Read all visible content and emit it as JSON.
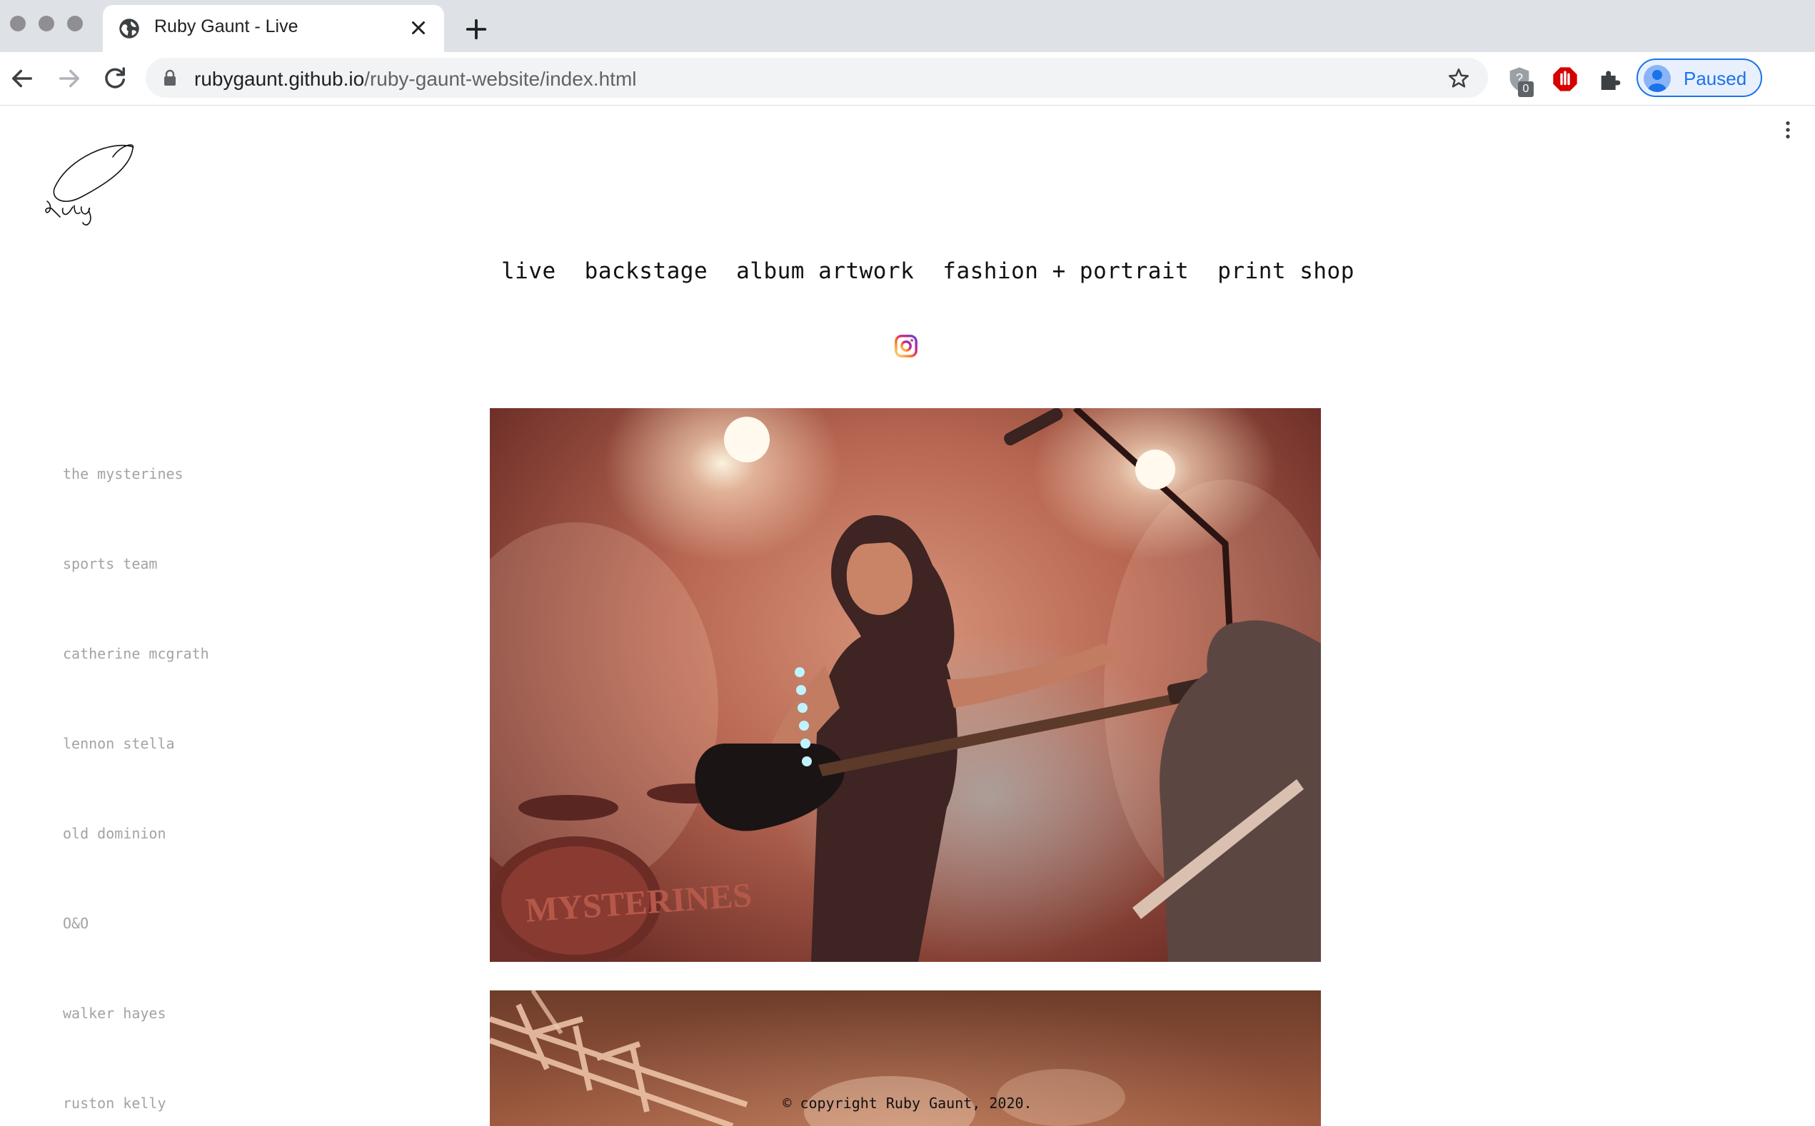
{
  "browser": {
    "tab_title": "Ruby Gaunt - Live",
    "url_host": "rubygaunt.github.io",
    "url_path": "/ruby-gaunt-website/index.html",
    "extension_badge": "0",
    "profile_label": "Paused"
  },
  "site": {
    "nav": [
      "live",
      "backstage",
      "album artwork",
      "fashion + portrait",
      "print shop"
    ],
    "sidebar": [
      "the mysterines",
      "sports team",
      "catherine mcgrath",
      "lennon stella",
      "old dominion",
      "O&O",
      "walker hayes",
      "ruston kelly"
    ],
    "copyright": "© copyright Ruby Gaunt, 2020."
  },
  "icons": {
    "tab": "globe-icon",
    "social": "instagram-icon",
    "logo": "signature-logo"
  },
  "colors": {
    "accent": "#1a73e8",
    "sidebar_text": "#a3a3a3"
  }
}
